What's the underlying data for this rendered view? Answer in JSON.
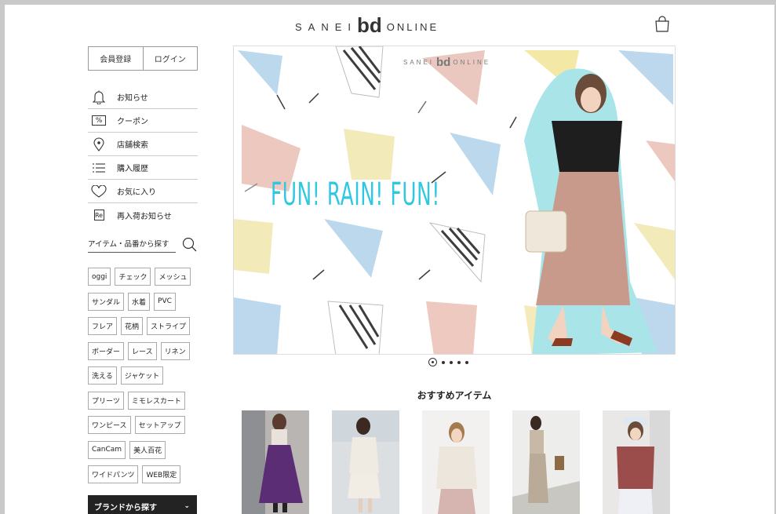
{
  "header": {
    "logo_prefix": "SANEI",
    "logo_mark": "bd",
    "logo_suffix": "ONLINE",
    "cart_icon": "shopping-bag-icon"
  },
  "auth": {
    "register_label": "会員登録",
    "login_label": "ログイン"
  },
  "menu": [
    {
      "label": "お知らせ",
      "icon": "bell-icon"
    },
    {
      "label": "クーポン",
      "icon": "coupon-icon"
    },
    {
      "label": "店舗検索",
      "icon": "location-pin-icon"
    },
    {
      "label": "購入履歴",
      "icon": "list-icon"
    },
    {
      "label": "お気に入り",
      "icon": "heart-icon"
    },
    {
      "label": "再入荷お知らせ",
      "icon": "restock-icon"
    }
  ],
  "menu_icon_text": {
    "coupon": "%",
    "restock": "Re"
  },
  "search": {
    "label": "アイテム・品番から探す"
  },
  "tags": [
    [
      "oggi",
      "チェック",
      "メッシュ"
    ],
    [
      "サンダル",
      "水着",
      "PVC"
    ],
    [
      "フレア",
      "花柄",
      "ストライプ"
    ],
    [
      "ボーダー",
      "レース",
      "リネン"
    ],
    [
      "洗える",
      "ジャケット"
    ],
    [
      "プリーツ",
      "ミモレスカート"
    ],
    [
      "ワンピース",
      "セットアップ"
    ],
    [
      "CanCam",
      "美人百花"
    ],
    [
      "ワイドパンツ",
      "WEB限定"
    ]
  ],
  "brand_button": {
    "label": "ブランドから探す",
    "chevron": "⌄"
  },
  "hero": {
    "headline": "FUN! RAIN! FUN!",
    "mini_logo_prefix": "SANEI",
    "mini_logo_mark": "bd",
    "mini_logo_suffix": "ONLINE",
    "slide_count": 5,
    "active_slide": 1
  },
  "recommended": {
    "title": "おすすめアイテム"
  },
  "colors": {
    "accent": "#2ec8e0",
    "dark_button": "#232323"
  }
}
